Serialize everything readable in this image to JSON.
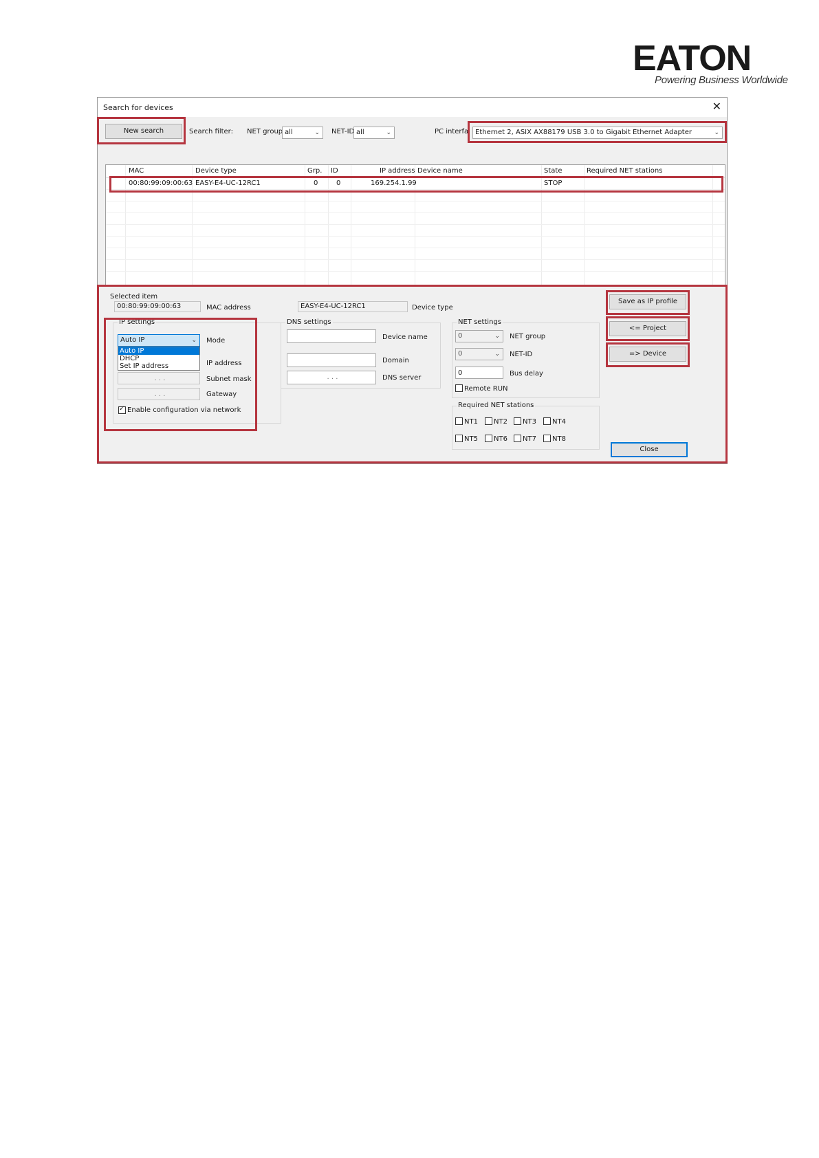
{
  "logo": {
    "word": "EATON",
    "tagline": "Powering Business Worldwide"
  },
  "dialog": {
    "title": "Search for devices",
    "close_glyph": "✕",
    "toolbar": {
      "new_search": "New search",
      "search_filter_label": "Search filter:",
      "net_group_label": "NET group",
      "net_group_value": "all",
      "net_id_label": "NET-ID",
      "net_id_value": "all",
      "pc_interface_label": "PC interface",
      "pc_interface_value": "Ethernet 2, ASIX AX88179 USB 3.0 to Gigabit Ethernet Adapter"
    },
    "table": {
      "columns": [
        "MAC",
        "Device type",
        "Grp.",
        "ID",
        "IP address",
        "Device name",
        "State",
        "Required NET stations"
      ],
      "rows": [
        {
          "mac": "00:80:99:09:00:63",
          "device_type": "EASY-E4-UC-12RC1",
          "grp": "0",
          "id": "0",
          "ip": "169.254.1.99",
          "device_name": "",
          "state": "STOP",
          "required": ""
        }
      ]
    },
    "selected": {
      "heading": "Selected item",
      "mac_value": "00:80:99:09:00:63",
      "mac_label": "MAC address",
      "device_type_value": "EASY-E4-UC-12RC1",
      "device_type_label": "Device type"
    },
    "ip_settings": {
      "title": "IP settings",
      "mode_value": "Auto IP",
      "mode_label": "Mode",
      "mode_options": [
        "Auto IP",
        "DHCP",
        "Set IP address"
      ],
      "ip_label": "IP address",
      "subnet_label": "Subnet mask",
      "gateway_label": "Gateway",
      "ip_placeholder": ".   .   .",
      "enable_label": "Enable configuration via network",
      "enable_checked": true
    },
    "dns_settings": {
      "title": "DNS settings",
      "device_name_label": "Device name",
      "domain_label": "Domain",
      "dns_server_label": "DNS server",
      "dns_placeholder": ".   .   ."
    },
    "net_settings": {
      "title": "NET settings",
      "net_group_value": "0",
      "net_group_label": "NET group",
      "net_id_value": "0",
      "net_id_label": "NET-ID",
      "bus_delay_value": "0",
      "bus_delay_label": "Bus delay",
      "remote_run_label": "Remote RUN",
      "required_title": "Required NET stations",
      "stations": [
        "NT1",
        "NT2",
        "NT3",
        "NT4",
        "NT5",
        "NT6",
        "NT7",
        "NT8"
      ]
    },
    "buttons": {
      "save_ip_profile": "Save as IP profile",
      "to_project": "<= Project",
      "to_device": "=> Device",
      "close": "Close"
    },
    "highlight_color": "#b5353f",
    "selection_color": "#0078d7"
  }
}
